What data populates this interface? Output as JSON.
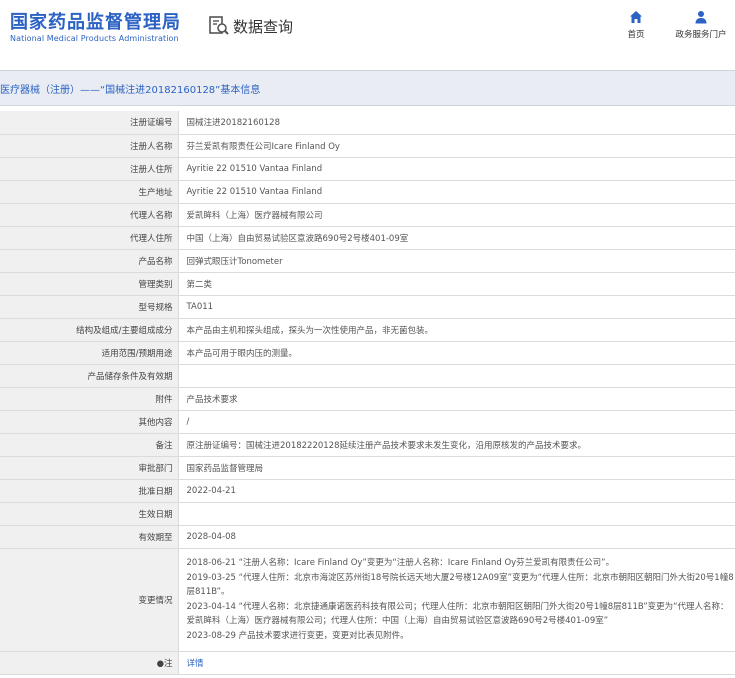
{
  "header": {
    "logo_cn": "国家药品监督管理局",
    "logo_en": "National Medical Products Administration",
    "query_label": "数据查询",
    "query_icon": "search-document-icon",
    "nav_home": "首页",
    "nav_home_icon": "home-icon",
    "nav_service": "政务服务门户",
    "nav_service_icon": "user-icon",
    "brand_color": "#2b62c4"
  },
  "title": "医疗器械（注册）——“国械注进20182160128”基本信息",
  "rows": [
    {
      "label": "注册证编号",
      "value": "国械注进20182160128"
    },
    {
      "label": "注册人名称",
      "value": "芬兰爱凯有限责任公司Icare Finland Oy"
    },
    {
      "label": "注册人住所",
      "value": "Ayritie 22 01510 Vantaa Finland"
    },
    {
      "label": "生产地址",
      "value": "Ayritie 22 01510 Vantaa Finland"
    },
    {
      "label": "代理人名称",
      "value": "爱凯眸科（上海）医疗器械有限公司"
    },
    {
      "label": "代理人住所",
      "value": "中国（上海）自由贸易试验区意波路690号2号楼401-09室"
    },
    {
      "label": "产品名称",
      "value": "回弹式眼压计Tonometer"
    },
    {
      "label": "管理类别",
      "value": "第二类"
    },
    {
      "label": "型号规格",
      "value": "TA011"
    },
    {
      "label": "结构及组成/主要组成成分",
      "value": "本产品由主机和探头组成，探头为一次性使用产品，非无菌包装。"
    },
    {
      "label": "适用范围/预期用途",
      "value": "本产品可用于眼内压的测量。"
    },
    {
      "label": "产品储存条件及有效期",
      "value": ""
    },
    {
      "label": "附件",
      "value": "产品技术要求"
    },
    {
      "label": "其他内容",
      "value": "/"
    },
    {
      "label": "备注",
      "value": "原注册证编号：国械注进20182220128延续注册产品技术要求未发生变化，沿用原核发的产品技术要求。"
    },
    {
      "label": "审批部门",
      "value": "国家药品监督管理局"
    },
    {
      "label": "批准日期",
      "value": "2022-04-21"
    },
    {
      "label": "生效日期",
      "value": ""
    },
    {
      "label": "有效期至",
      "value": "2028-04-08"
    }
  ],
  "changes": {
    "label": "变更情况",
    "lines": [
      "2018-06-21 “注册人名称：Icare Finland Oy”变更为“注册人名称：Icare Finland Oy芬兰爱凯有限责任公司”。",
      "2019-03-25 “代理人住所：北京市海淀区苏州街18号院长远天地大厦2号楼12A09室”变更为“代理人住所：北京市朝阳区朝阳门外大街20号1幢8层811B”。",
      "2023-04-14 “代理人名称：北京捷通康诺医药科技有限公司；代理人住所：北京市朝阳区朝阳门外大街20号1幢8层811B”变更为“代理人名称：爱凯眸科（上海）医疗器械有限公司；代理人住所：中国（上海）自由贸易试验区意波路690号2号楼401-09室”",
      "2023-08-29 产品技术要求进行变更，变更对比表见附件。"
    ]
  },
  "note": {
    "label": "注",
    "label_marker": "●",
    "link": "详情"
  }
}
